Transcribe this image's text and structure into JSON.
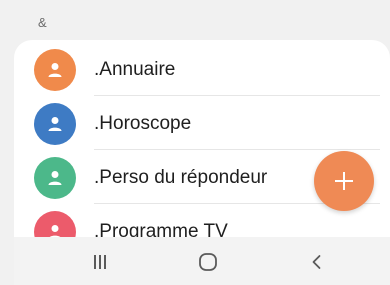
{
  "section_header": "&",
  "contacts": [
    {
      "name": ".Annuaire",
      "avatar_color": "#f08a4b"
    },
    {
      "name": ".Horoscope",
      "avatar_color": "#3e7bc4"
    },
    {
      "name": ".Perso du répondeur",
      "avatar_color": "#4cb88a"
    },
    {
      "name": ".Programme TV",
      "avatar_color": "#ec5b6b"
    }
  ],
  "avatar_icon": "person-icon",
  "fab": {
    "icon": "plus-icon",
    "color": "#ef8a55"
  },
  "navigation": {
    "recent_apps_icon": "recent-apps-icon",
    "home_icon": "home-icon",
    "back_icon": "back-icon"
  }
}
